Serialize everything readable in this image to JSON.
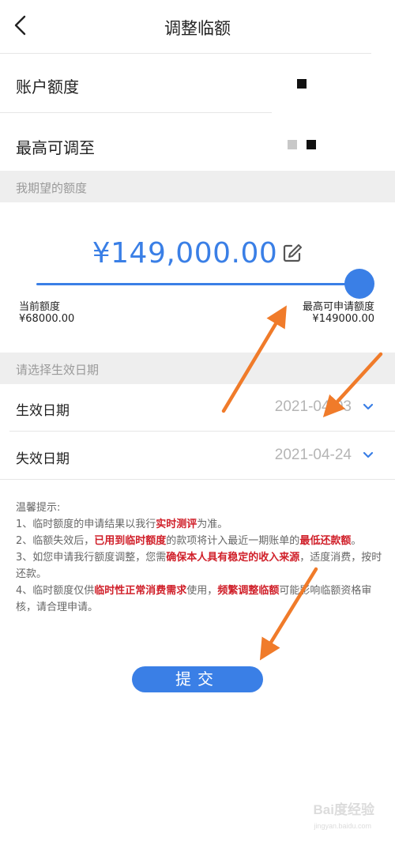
{
  "header": {
    "title": "调整临额"
  },
  "account": {
    "label": "账户额度",
    "value_color": "#111111"
  },
  "max_adjust": {
    "label": "最高可调至"
  },
  "desired_section": {
    "label": "我期望的额度"
  },
  "amount": {
    "display": "¥149,000.00"
  },
  "slider": {
    "fill_fraction": 1.0,
    "left_label": "当前额度",
    "left_value": "¥68000.00",
    "right_label": "最高可申请额度",
    "right_value": "¥149000.00"
  },
  "date_section": {
    "label": "请选择生效日期"
  },
  "effective_date": {
    "label": "生效日期",
    "value": "2021-04-03"
  },
  "expire_date": {
    "label": "失效日期",
    "value": "2021-04-24"
  },
  "tips": {
    "title": "温馨提示:",
    "line1_a": "1、临时额度的申请结果以我行",
    "line1_b": "实时测评",
    "line1_c": "为准。",
    "line2_a": "2、临额失效后，",
    "line2_b": "已用到临时额度",
    "line2_c": "的款项将计入最近一期账单的",
    "line2_d": "最低还款额",
    "line2_e": "。",
    "line3_a": "3、如您申请我行额度调整，您需",
    "line3_b": "确保本人具有稳定的收入来源",
    "line3_c": "，适度消费，按时还款。",
    "line4_a": "4、临时额度仅供",
    "line4_b": "临时性正常消费需求",
    "line4_c": "使用，",
    "line4_d": "频繁调整临额",
    "line4_e": "可能影响临额资格审核，请合理申请。"
  },
  "submit": {
    "label": "提交"
  },
  "watermark": {
    "main": "Bai度经验",
    "sub": "jingyan.baidu.com"
  },
  "colors": {
    "accent": "#3a7fe6",
    "warning": "#d0202a",
    "annotation_arrow": "#f07b2a"
  }
}
